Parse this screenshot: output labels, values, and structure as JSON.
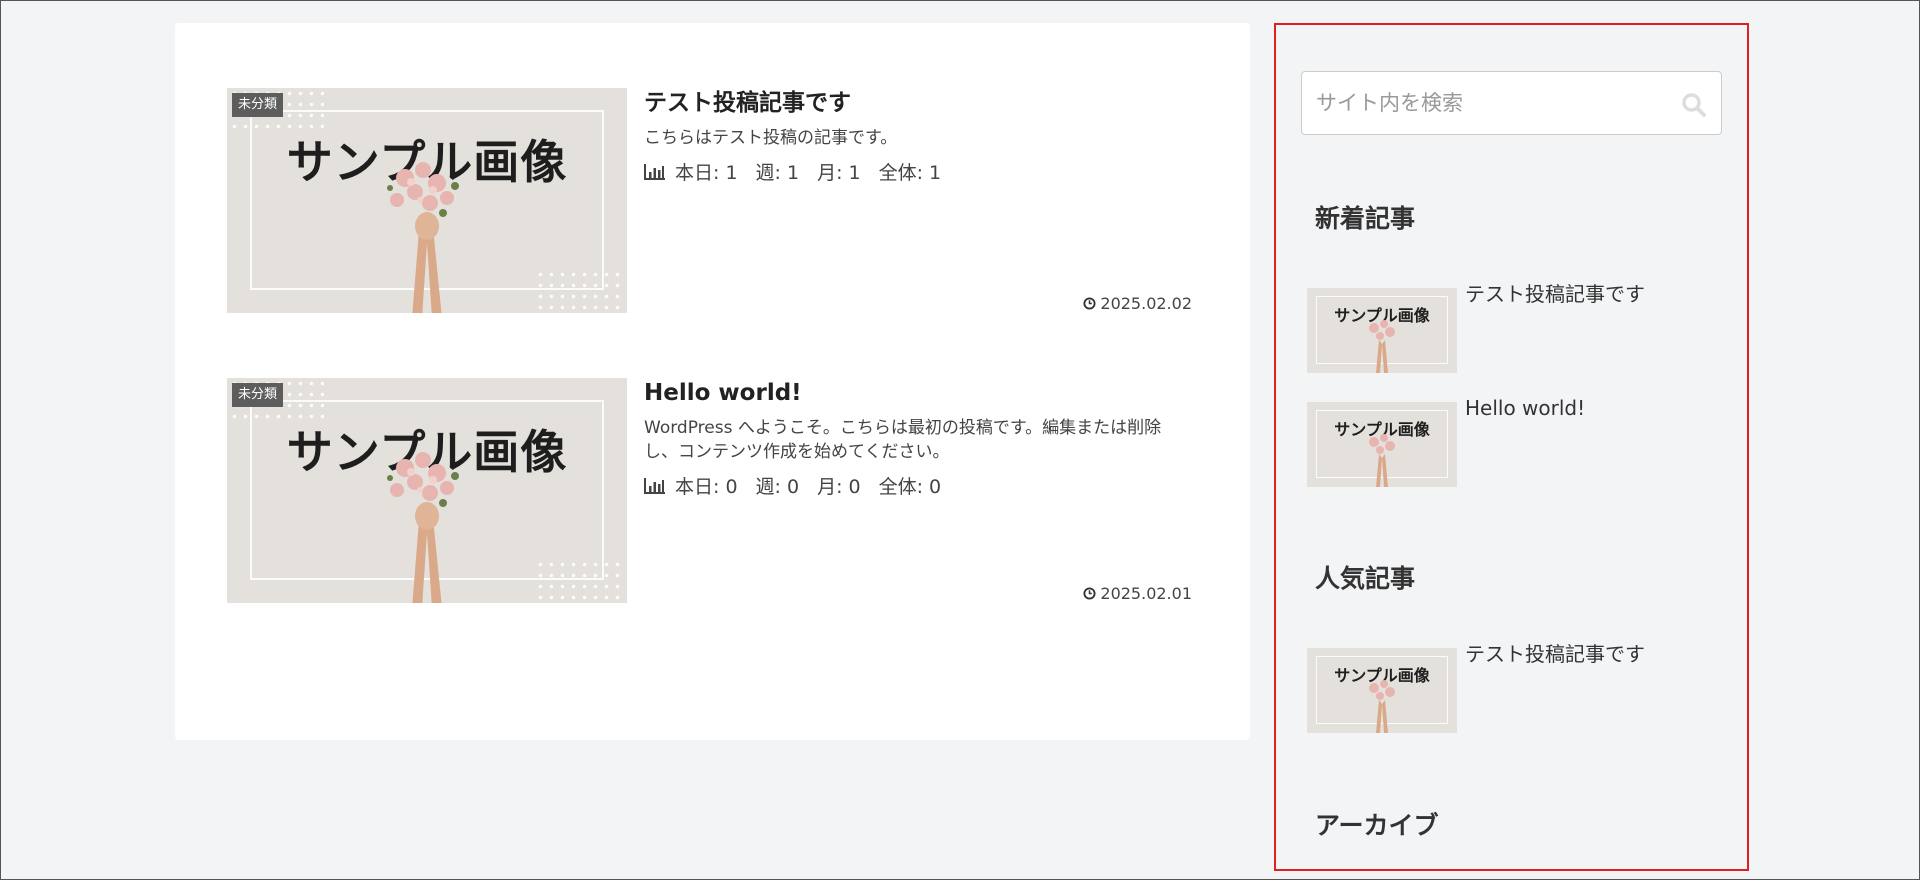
{
  "posts": [
    {
      "category": "未分類",
      "thumb_text": "サンプル画像",
      "title": "テスト投稿記事です",
      "excerpt": "こちらはテスト投稿の記事です。",
      "stats": {
        "today": "本日: 1",
        "week": "週: 1",
        "month": "月: 1",
        "total": "全体: 1"
      },
      "date": "2025.02.02"
    },
    {
      "category": "未分類",
      "thumb_text": "サンプル画像",
      "title": "Hello world!",
      "excerpt": "WordPress へようこそ。こちらは最初の投稿です。編集または削除し、コンテンツ作成を始めてください。",
      "stats": {
        "today": "本日: 0",
        "week": "週: 0",
        "month": "月: 0",
        "total": "全体: 0"
      },
      "date": "2025.02.01"
    }
  ],
  "sidebar": {
    "search_placeholder": "サイト内を検索",
    "new_posts_heading": "新着記事",
    "new_posts": [
      {
        "thumb_text": "サンプル画像",
        "title": "テスト投稿記事です"
      },
      {
        "thumb_text": "サンプル画像",
        "title": "Hello world!"
      }
    ],
    "popular_heading": "人気記事",
    "popular_posts": [
      {
        "thumb_text": "サンプル画像",
        "title": "テスト投稿記事です"
      }
    ],
    "archive_heading": "アーカイブ"
  },
  "colors": {
    "page_bg": "#f3f4f6",
    "card_bg": "#ffffff",
    "highlight_border": "#e02020",
    "badge_bg": "#5d5d5d"
  },
  "icons": [
    "bar-chart-icon",
    "clock-icon",
    "search-icon"
  ]
}
